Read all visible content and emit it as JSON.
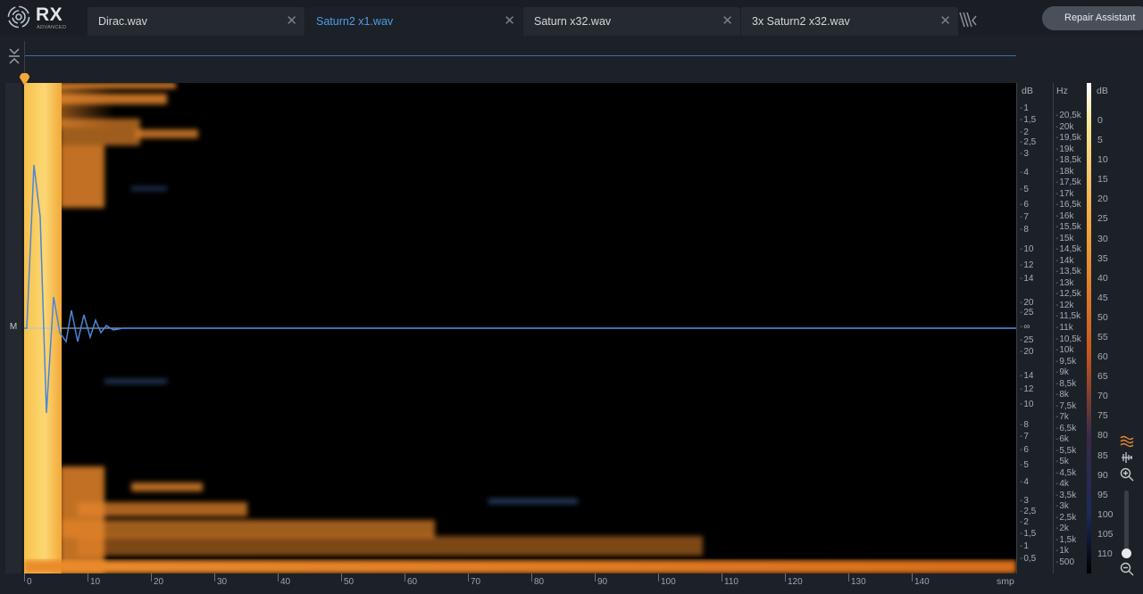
{
  "app": {
    "logo_text": "RX",
    "logo_sub": "ADVANCED"
  },
  "tabs": [
    {
      "label": "Dirac.wav",
      "active": false
    },
    {
      "label": "Saturn2 x1.wav",
      "active": true
    },
    {
      "label": "Saturn x32.wav",
      "active": false
    },
    {
      "label": "3x Saturn2 x32.wav",
      "active": false
    }
  ],
  "repair_button": {
    "label": "Repair Assistant"
  },
  "channel": {
    "label": "M"
  },
  "x_axis": {
    "unit": "smp",
    "ticks": [
      "0",
      "10",
      "20",
      "30",
      "40",
      "50",
      "60",
      "70",
      "80",
      "90",
      "100",
      "110",
      "120",
      "130",
      "140"
    ]
  },
  "waveform_db_axis": {
    "unit": "dB",
    "labels": [
      "-1",
      "-1,5",
      "-2",
      "-2,5",
      "-3",
      "-4",
      "-5",
      "-6",
      "-7",
      "-8",
      "-10",
      "-12",
      "-14",
      "-20",
      "-25",
      "-∞",
      "-25",
      "-20",
      "-14",
      "-12",
      "-10",
      "-8",
      "-7",
      "-6",
      "-5",
      "-4",
      "-3",
      "-2,5",
      "-2",
      "-1,5",
      "-1",
      "-0,5"
    ]
  },
  "frequency_axis": {
    "unit": "Hz",
    "labels": [
      "20,5k",
      "20k",
      "19,5k",
      "19k",
      "18,5k",
      "18k",
      "17,5k",
      "17k",
      "16,5k",
      "16k",
      "15,5k",
      "15k",
      "14,5k",
      "14k",
      "13,5k",
      "13k",
      "12,5k",
      "12k",
      "11,5k",
      "11k",
      "10,5k",
      "10k",
      "9,5k",
      "9k",
      "8,5k",
      "8k",
      "7,5k",
      "7k",
      "6,5k",
      "6k",
      "5,5k",
      "5k",
      "4,5k",
      "4k",
      "3,5k",
      "3k",
      "2,5k",
      "2k",
      "1,5k",
      "1k",
      "500"
    ]
  },
  "colorbar": {
    "unit": "dB",
    "labels": [
      "0",
      "5",
      "10",
      "15",
      "20",
      "25",
      "30",
      "35",
      "40",
      "45",
      "50",
      "55",
      "60",
      "65",
      "70",
      "75",
      "80",
      "85",
      "90",
      "95",
      "100",
      "105",
      "110"
    ]
  },
  "colors": {
    "accent": "#4d9ce6",
    "waveform": "#4a86d8",
    "spectrogram_hot": "#f7c24f",
    "spectrogram_mid": "#e07a1e"
  },
  "tools": [
    "spectrogram-mode-icon",
    "waveform-mode-icon",
    "zoom-in-icon",
    "zoom-out-icon"
  ]
}
